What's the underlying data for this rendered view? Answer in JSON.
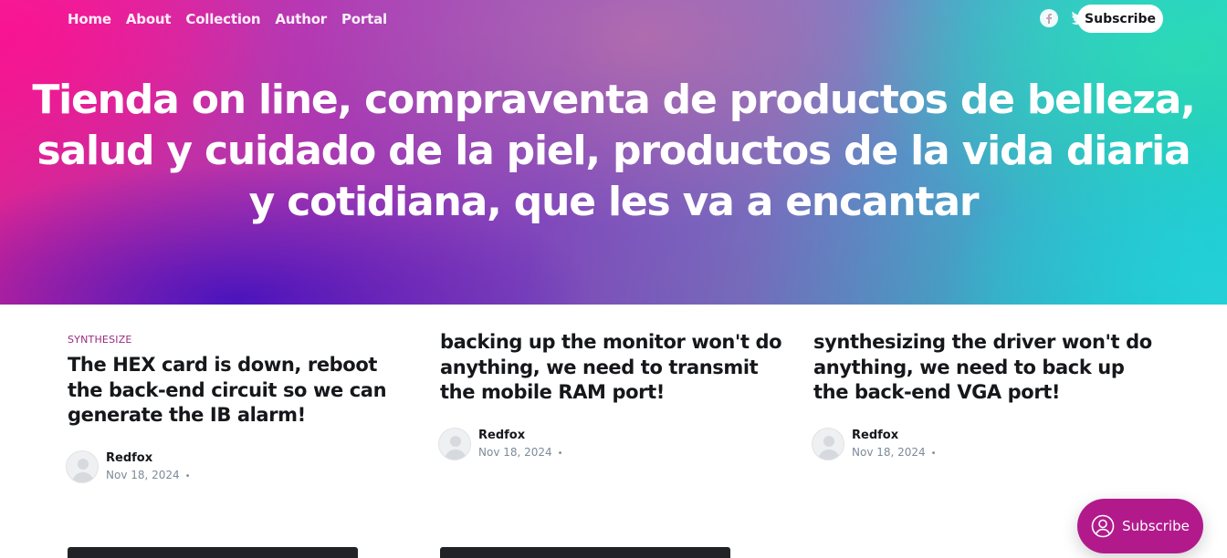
{
  "nav": {
    "items": [
      "Home",
      "About",
      "Collection",
      "Author",
      "Portal"
    ]
  },
  "header": {
    "social": [
      "facebook-icon",
      "twitter-icon"
    ],
    "subscribe_label": "Subscribe"
  },
  "hero": {
    "title": "Tienda on line, compraventa de productos de belleza, salud y cuidado de la piel, productos de la vida diaria y cotidiana, que les va a encantar"
  },
  "posts": [
    {
      "tag": "SYNTHESIZE",
      "title": "The HEX card is down, reboot the back-end circuit so we can generate the IB alarm!",
      "author": "Redfox",
      "date": "Nov 18, 2024"
    },
    {
      "tag": "",
      "title": "backing up the monitor won't do anything, we need to transmit the mobile RAM port!",
      "author": "Redfox",
      "date": "Nov 18, 2024"
    },
    {
      "tag": "",
      "title": "synthesizing the driver won't do anything, we need to back up the back-end VGA port!",
      "author": "Redfox",
      "date": "Nov 18, 2024"
    }
  ],
  "portal": {
    "subscribe_label": "Subscribe"
  },
  "colors": {
    "accent": "#b21a8c",
    "tag": "#9a2a7e"
  }
}
